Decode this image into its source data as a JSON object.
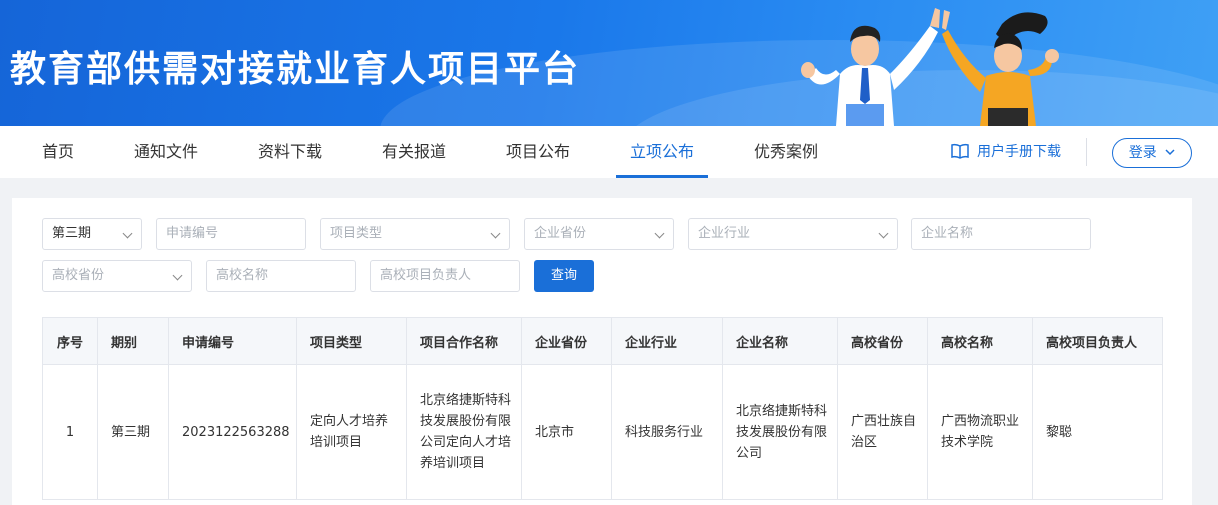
{
  "header": {
    "title": "教育部供需对接就业育人项目平台"
  },
  "nav": {
    "items": [
      {
        "label": "首页"
      },
      {
        "label": "通知文件"
      },
      {
        "label": "资料下载"
      },
      {
        "label": "有关报道"
      },
      {
        "label": "项目公布"
      },
      {
        "label": "立项公布"
      },
      {
        "label": "优秀案例"
      }
    ],
    "active_index": 5,
    "manual_label": "用户手册下载",
    "login_label": "登录"
  },
  "filters": {
    "period": {
      "value": "第三期"
    },
    "application_no": {
      "placeholder": "申请编号"
    },
    "project_type": {
      "placeholder": "项目类型"
    },
    "company_province": {
      "placeholder": "企业省份"
    },
    "company_industry": {
      "placeholder": "企业行业"
    },
    "company_name": {
      "placeholder": "企业名称"
    },
    "school_province": {
      "placeholder": "高校省份"
    },
    "school_name": {
      "placeholder": "高校名称"
    },
    "school_lead": {
      "placeholder": "高校项目负责人"
    },
    "search_label": "查询"
  },
  "table": {
    "headers": [
      "序号",
      "期别",
      "申请编号",
      "项目类型",
      "项目合作名称",
      "企业省份",
      "企业行业",
      "企业名称",
      "高校省份",
      "高校名称",
      "高校项目负责人"
    ],
    "rows": [
      {
        "index": "1",
        "period": "第三期",
        "application_no": "2023122563288",
        "project_type": "定向人才培养培训项目",
        "cooperation_name": "北京络捷斯特科技发展股份有限公司定向人才培养培训项目",
        "company_province": "北京市",
        "company_industry": "科技服务行业",
        "company_name": "北京络捷斯特科技发展股份有限公司",
        "school_province": "广西壮族自治区",
        "school_name": "广西物流职业技术学院",
        "school_lead": "黎聪"
      }
    ]
  },
  "colors": {
    "primary": "#1a6fd8",
    "banner": "#1a78ea"
  }
}
